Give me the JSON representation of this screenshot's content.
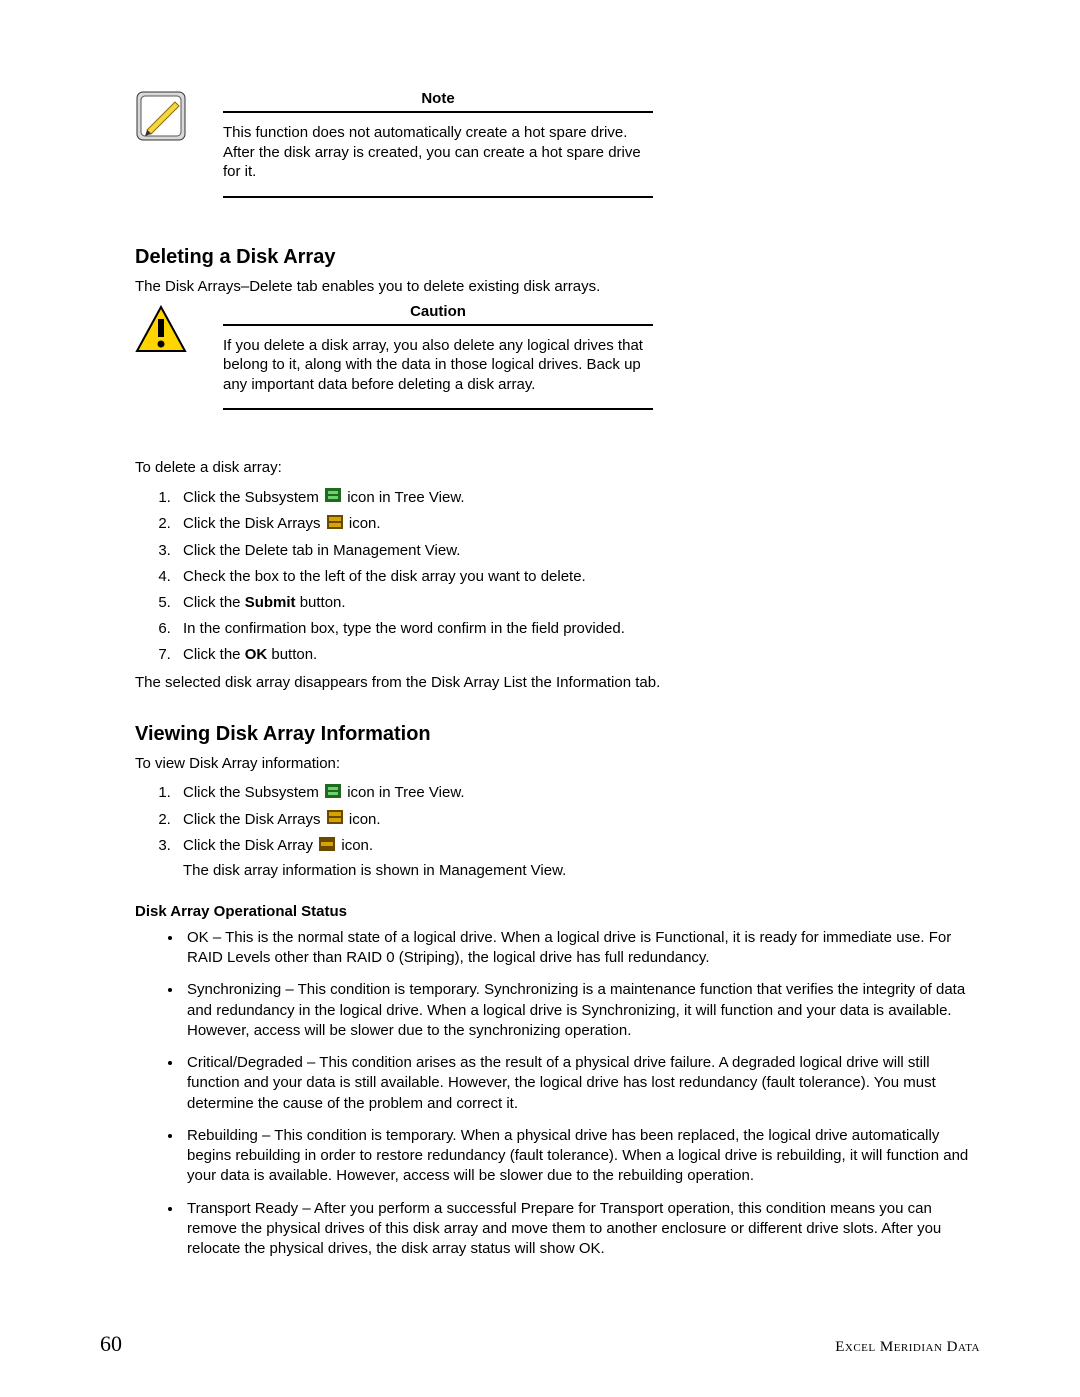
{
  "note": {
    "title": "Note",
    "text": "This function does not automatically create a hot spare drive. After the disk array is created, you can create a hot spare drive for it."
  },
  "section1": {
    "heading": "Deleting a Disk Array",
    "intro": "The Disk Arrays–Delete tab enables you to delete existing disk arrays."
  },
  "caution": {
    "title": "Caution",
    "text": "If you delete a disk array, you also delete any logical drives that belong to it, along with the data in those logical drives. Back up any important data before deleting a disk array."
  },
  "delete": {
    "lead": "To delete a disk array:",
    "step1a": "Click the Subsystem ",
    "step1b": " icon in Tree View.",
    "step2a": "Click the Disk Arrays ",
    "step2b": " icon.",
    "step3": "Click the Delete tab in Management View.",
    "step4": "Check the box to the left of the disk array you want to delete.",
    "step5a": "Click the ",
    "step5b": "Submit",
    "step5c": " button.",
    "step6": "In the confirmation box, type the word confirm in the field provided.",
    "step7a": "Click the ",
    "step7b": "OK",
    "step7c": " button.",
    "after": "The selected disk array disappears from the Disk Array List the Information tab."
  },
  "section2": {
    "heading": "Viewing Disk Array Information",
    "lead": "To view Disk Array information:",
    "step1a": "Click the Subsystem ",
    "step1b": " icon in Tree View.",
    "step2a": "Click the Disk Arrays ",
    "step2b": " icon.",
    "step3a": "Click the Disk Array ",
    "step3b": " icon.",
    "step3sub": "The disk array information is shown in Management View."
  },
  "opstatus": {
    "heading": "Disk Array Operational Status",
    "b1": "OK – This is the normal state of a logical drive. When a logical drive is Functional, it is ready for immediate use. For RAID Levels other than RAID 0 (Striping), the logical drive has full redundancy.",
    "b2": "Synchronizing – This condition is temporary. Synchronizing is a maintenance function that verifies the integrity of data and redundancy in the logical drive. When a logical drive is Synchronizing, it will function and your data is available. However, access will be slower due to the synchronizing operation.",
    "b3": "Critical/Degraded – This condition arises as the result of a physical drive failure. A degraded logical drive will still function and your data is still available. However, the logical drive has lost redundancy (fault tolerance). You must determine the cause of the problem and correct it.",
    "b4": "Rebuilding – This condition is temporary. When a physical drive has been replaced, the logical drive automatically begins rebuilding in order to restore redundancy (fault tolerance). When a logical drive is rebuilding, it will function and your data is available. However, access will be slower due to the rebuilding operation.",
    "b5": "Transport Ready – After you perform a successful Prepare for Transport operation, this condition means you can remove the physical drives of this disk array and move them to another enclosure or different drive slots. After you relocate the physical drives, the disk array status will show OK."
  },
  "footer": {
    "page": "60",
    "right": "Excel Meridian Data"
  }
}
